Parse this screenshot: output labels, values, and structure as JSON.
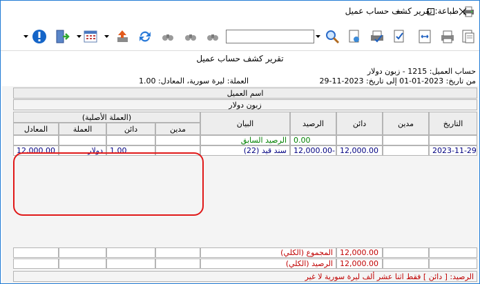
{
  "window": {
    "title": "طباعة: تقرير كشف حساب عميل",
    "controls": [
      "minimize",
      "maximize",
      "close"
    ]
  },
  "toolbar": {
    "search_value": "",
    "icons": [
      "print-icon",
      "print-preview-icon",
      "fit-width-icon",
      "check-doc-icon",
      "printer-check-icon",
      "page-setup-icon",
      "zoom-icon",
      "prev-binoculars-icon",
      "next-binoculars-icon",
      "back-binoculars-icon",
      "refresh-icon",
      "export-icon",
      "calendar-icon",
      "exit-door-icon",
      "info-icon"
    ]
  },
  "report": {
    "title": "تقرير كشف حساب عميل",
    "account_label": "حساب العميل:",
    "account_value": "1215 - زبون دولار",
    "from_label": "من تاريخ:",
    "from_value": "2023-01-01",
    "to_label": "إلى تاريخ:",
    "to_value": "2023-11-29",
    "currency_label": "العملة:",
    "currency_value": "ليرة سورية",
    "rate_label": "المعادل:",
    "rate_value": "1.00",
    "customer_name_label": "اسم العميل",
    "customer_name_value": "زبون دولار",
    "columns": {
      "date": "التاريخ",
      "debit": "مدين",
      "credit": "دائن",
      "balance": "الرصيد",
      "statement": "البيان",
      "orig_group": "(العملة الأصلية)",
      "orig_debit": "مدين",
      "orig_credit": "دائن",
      "orig_currency": "العملة",
      "orig_equiv": "المعادل"
    },
    "rows": [
      {
        "date": "",
        "debit": "",
        "credit": "",
        "balance": "0.00",
        "statement": "الرصيد السابق",
        "orig_debit": "",
        "orig_credit": "",
        "orig_currency": "",
        "orig_equiv": ""
      },
      {
        "date": "2023-11-29",
        "debit": "",
        "credit": "12,000.00",
        "balance": "12,000.00-",
        "statement": "سند قيد (22)",
        "orig_debit": "",
        "orig_credit": "1.00",
        "orig_currency": "دولار",
        "orig_equiv": "12,000.00"
      }
    ],
    "totals": [
      {
        "label": "المجموع (الكلي)",
        "credit": "12,000.00"
      },
      {
        "label": "الرصيد (الكلي)",
        "credit": "12,000.00"
      }
    ],
    "balance_text": "الرصيد: [ دائن ] فقط اثنا عشر ألف ليرة سورية لا غير",
    "highlight_color": "#e01818"
  }
}
